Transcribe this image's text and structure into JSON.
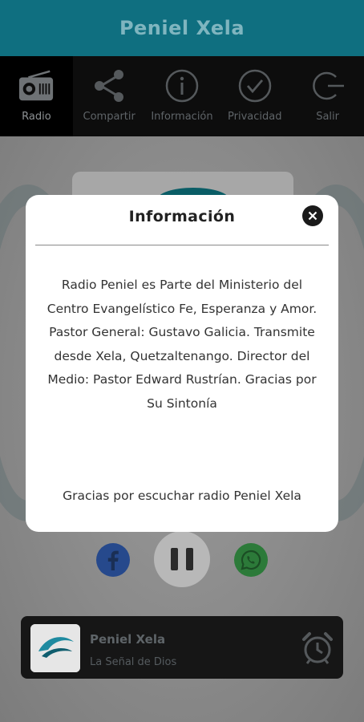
{
  "app": {
    "title": "Peniel Xela"
  },
  "toolbar": {
    "items": [
      {
        "label": "Radio",
        "icon": "radio-icon",
        "active": true
      },
      {
        "label": "Compartir",
        "icon": "share-icon"
      },
      {
        "label": "Información",
        "icon": "info-icon"
      },
      {
        "label": "Privacidad",
        "icon": "check-circle-icon"
      },
      {
        "label": "Salir",
        "icon": "exit-icon"
      }
    ]
  },
  "dialog": {
    "title": "Información",
    "body": "Radio Peniel es Parte del Ministerio del Centro Evangelístico Fe, Esperanza y Amor. Pastor General: Gustavo Galicia. Transmite desde Xela, Quetzaltenango. Director del Medio: Pastor Edward Rustrían. Gracias por Su Sintonía",
    "thanks": "Gracias por escuchar radio Peniel Xela"
  },
  "player": {
    "station": "Peniel Xela",
    "slogan": "La Señal de Dios"
  },
  "colors": {
    "app_bar": "#0f6f80",
    "toolbar": "#0d0d0d",
    "facebook": "#26498c",
    "whatsapp": "#2c7a39"
  }
}
